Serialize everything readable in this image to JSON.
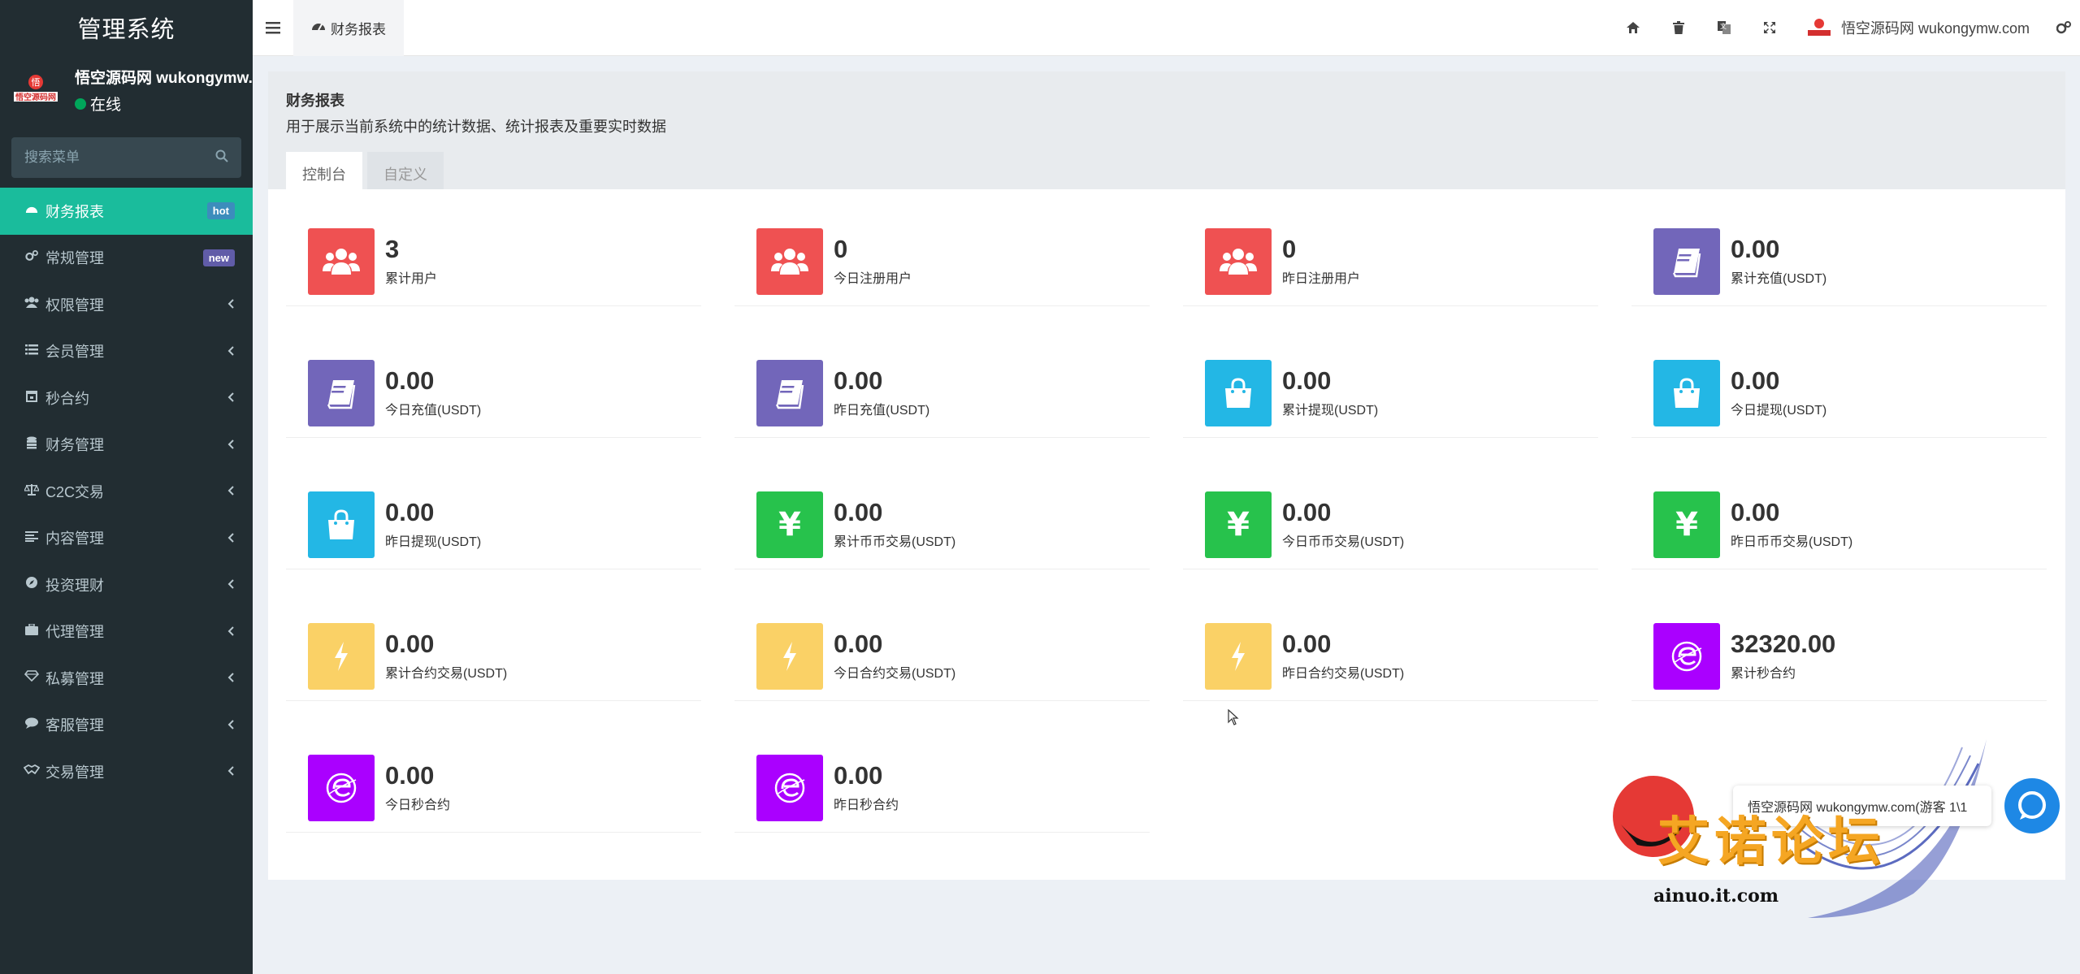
{
  "sidebar": {
    "brand": "管理系统",
    "user_name": "悟空源码网 wukongymw.com",
    "status": "在线",
    "search_placeholder": "搜索菜单",
    "items": [
      {
        "label": "财务报表",
        "icon": "dashboard-icon",
        "badge": "hot",
        "active": true
      },
      {
        "label": "常规管理",
        "icon": "cogs-icon",
        "badge": "new"
      },
      {
        "label": "权限管理",
        "icon": "group-icon"
      },
      {
        "label": "会员管理",
        "icon": "list-icon"
      },
      {
        "label": "秒合约",
        "icon": "calendar-icon"
      },
      {
        "label": "财务管理",
        "icon": "database-icon"
      },
      {
        "label": "C2C交易",
        "icon": "balance-scale-icon"
      },
      {
        "label": "内容管理",
        "icon": "align-left-icon"
      },
      {
        "label": "投资理财",
        "icon": "compass-icon"
      },
      {
        "label": "代理管理",
        "icon": "briefcase-icon"
      },
      {
        "label": "私募管理",
        "icon": "diamond-icon"
      },
      {
        "label": "客服管理",
        "icon": "comment-icon"
      },
      {
        "label": "交易管理",
        "icon": "handshake-icon"
      }
    ]
  },
  "header": {
    "tab_label": "财务报表",
    "user_name": "悟空源码网 wukongymw.com"
  },
  "panel": {
    "title": "财务报表",
    "description": "用于展示当前系统中的统计数据、统计报表及重要实时数据",
    "tabs": [
      "控制台",
      "自定义"
    ]
  },
  "stats": [
    {
      "value": "3",
      "label": "累计用户",
      "icon": "users-icon",
      "color": "#ef5152"
    },
    {
      "value": "0",
      "label": "今日注册用户",
      "icon": "users-icon",
      "color": "#ef5152"
    },
    {
      "value": "0",
      "label": "昨日注册用户",
      "icon": "users-icon",
      "color": "#ef5152"
    },
    {
      "value": "0.00",
      "label": "累计充值(USDT)",
      "icon": "book-icon",
      "color": "#7266ba"
    },
    {
      "value": "0.00",
      "label": "今日充值(USDT)",
      "icon": "book-icon",
      "color": "#7266ba"
    },
    {
      "value": "0.00",
      "label": "昨日充值(USDT)",
      "icon": "book-icon",
      "color": "#7266ba"
    },
    {
      "value": "0.00",
      "label": "累计提现(USDT)",
      "icon": "shopping-bag-icon",
      "color": "#23b7e5"
    },
    {
      "value": "0.00",
      "label": "今日提现(USDT)",
      "icon": "shopping-bag-icon",
      "color": "#23b7e5"
    },
    {
      "value": "0.00",
      "label": "昨日提现(USDT)",
      "icon": "shopping-bag-icon",
      "color": "#23b7e5"
    },
    {
      "value": "0.00",
      "label": "累计币币交易(USDT)",
      "icon": "yen-icon",
      "color": "#27c24c"
    },
    {
      "value": "0.00",
      "label": "今日币币交易(USDT)",
      "icon": "yen-icon",
      "color": "#27c24c"
    },
    {
      "value": "0.00",
      "label": "昨日币币交易(USDT)",
      "icon": "yen-icon",
      "color": "#27c24c"
    },
    {
      "value": "0.00",
      "label": "累计合约交易(USDT)",
      "icon": "bolt-icon",
      "color": "#fad166"
    },
    {
      "value": "0.00",
      "label": "今日合约交易(USDT)",
      "icon": "bolt-icon",
      "color": "#fad166"
    },
    {
      "value": "0.00",
      "label": "昨日合约交易(USDT)",
      "icon": "bolt-icon",
      "color": "#fad166"
    },
    {
      "value": "32320.00",
      "label": "累计秒合约",
      "icon": "ethereum-icon",
      "color": "#aa00ff"
    },
    {
      "value": "0.00",
      "label": "今日秒合约",
      "icon": "ethereum-icon",
      "color": "#aa00ff"
    },
    {
      "value": "0.00",
      "label": "昨日秒合约",
      "icon": "ethereum-icon",
      "color": "#aa00ff"
    }
  ],
  "chat": {
    "tip": "悟空源码网 wukongymw.com(游客 1\\1"
  },
  "watermark": {
    "text": "艾诺论坛",
    "url": "ainuo.it.com"
  }
}
